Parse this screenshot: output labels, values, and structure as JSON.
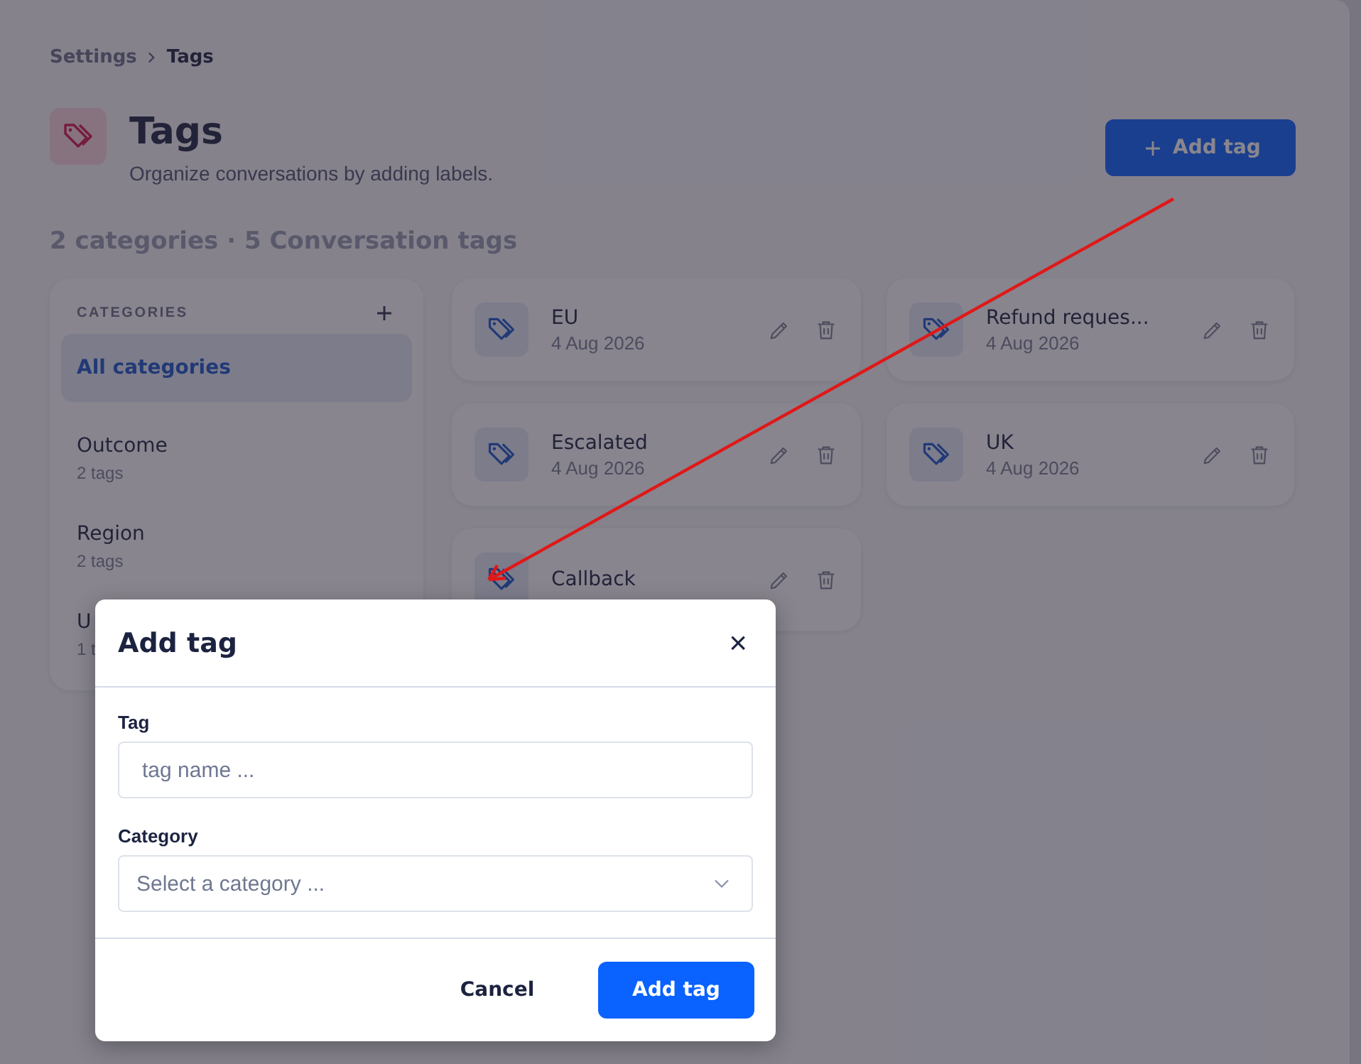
{
  "breadcrumb": [
    {
      "label": "Settings",
      "selected": false
    },
    {
      "label": "Tags",
      "selected": true
    }
  ],
  "header": {
    "title": "Tags",
    "subtitle": "Organize conversations by adding labels.",
    "add_button": "Add tag"
  },
  "summary": "2 categories · 5 Conversation tags",
  "categories": {
    "heading": "CATEGORIES",
    "items": [
      {
        "name": "All categories",
        "selected": true
      },
      {
        "name": "Outcome",
        "count": "2 tags",
        "selected": false
      },
      {
        "name": "Region",
        "count": "2 tags",
        "selected": false
      },
      {
        "name": "U",
        "count": "1 t",
        "selected": false
      }
    ]
  },
  "tags": [
    {
      "name": "EU",
      "date": "4 Aug 2026"
    },
    {
      "name": "Refund reques...",
      "date": "4 Aug 2026"
    },
    {
      "name": "Escalated",
      "date": "4 Aug 2026"
    },
    {
      "name": "UK",
      "date": "4 Aug 2026"
    },
    {
      "name": "Callback"
    }
  ],
  "modal": {
    "title": "Add tag",
    "close": "×",
    "fields": [
      {
        "kind": "text",
        "label": "Tag",
        "placeholder": "tag name ..."
      },
      {
        "kind": "select",
        "label": "Category",
        "placeholder": "Select a category ..."
      }
    ],
    "buttons": [
      {
        "kind": "secondary",
        "label": "Cancel"
      },
      {
        "kind": "primary",
        "label": "Add tag"
      }
    ]
  }
}
